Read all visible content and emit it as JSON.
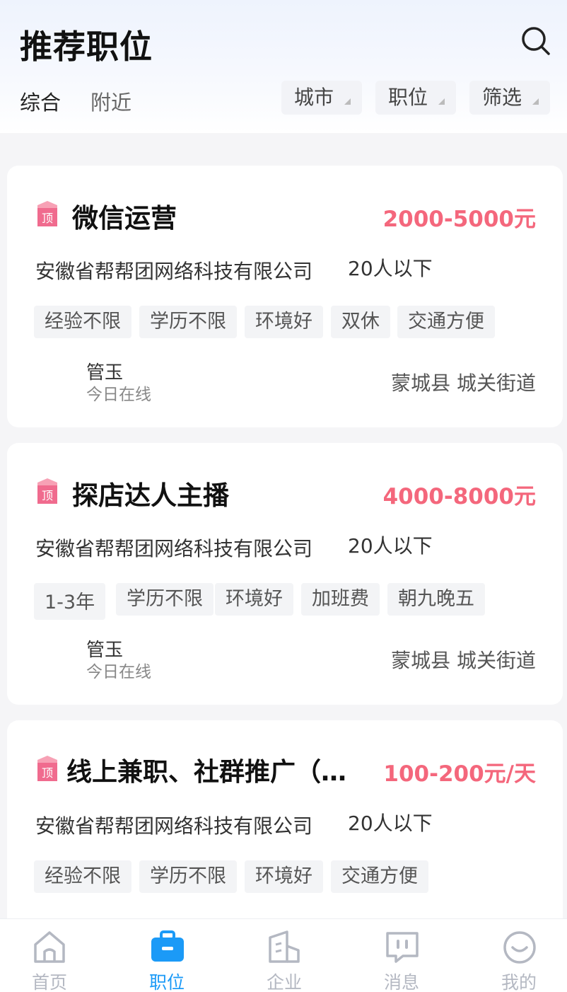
{
  "header": {
    "title": "推荐职位",
    "tabs": [
      {
        "label": "综合",
        "active": true
      },
      {
        "label": "附近",
        "active": false
      }
    ],
    "filters": [
      {
        "label": "城市"
      },
      {
        "label": "职位"
      },
      {
        "label": "筛选"
      }
    ]
  },
  "jobs": [
    {
      "title": "微信运营",
      "salary": "2000-5000元",
      "company": "安徽省帮帮团网络科技有限公司",
      "size": "20人以下",
      "tags": [
        "经验不限",
        "学历不限",
        "环境好",
        "双休",
        "交通方便"
      ],
      "recruiter": "管玉",
      "status": "今日在线",
      "location": "蒙城县 城关街道"
    },
    {
      "title": "探店达人主播",
      "salary": "4000-8000元",
      "company": "安徽省帮帮团网络科技有限公司",
      "size": "20人以下",
      "tags": [
        "1-3年",
        "学历不限",
        "环境好",
        "加班费",
        "朝九晚五"
      ],
      "recruiter": "管玉",
      "status": "今日在线",
      "location": "蒙城县 城关街道"
    },
    {
      "title": "线上兼职、社群推广（…",
      "salary": "100-200元/天",
      "company": "安徽省帮帮团网络科技有限公司",
      "size": "20人以下",
      "tags": [
        "经验不限",
        "学历不限",
        "环境好",
        "交通方便"
      ]
    }
  ],
  "tabbar": [
    {
      "label": "首页",
      "icon": "home-icon",
      "active": false
    },
    {
      "label": "职位",
      "icon": "briefcase-icon",
      "active": true
    },
    {
      "label": "企业",
      "icon": "building-icon",
      "active": false
    },
    {
      "label": "消息",
      "icon": "message-icon",
      "active": false
    },
    {
      "label": "我的",
      "icon": "profile-icon",
      "active": false
    }
  ],
  "colors": {
    "accent": "#1b9af7",
    "salary": "#f4677c",
    "inactive": "#b4b8c2"
  }
}
